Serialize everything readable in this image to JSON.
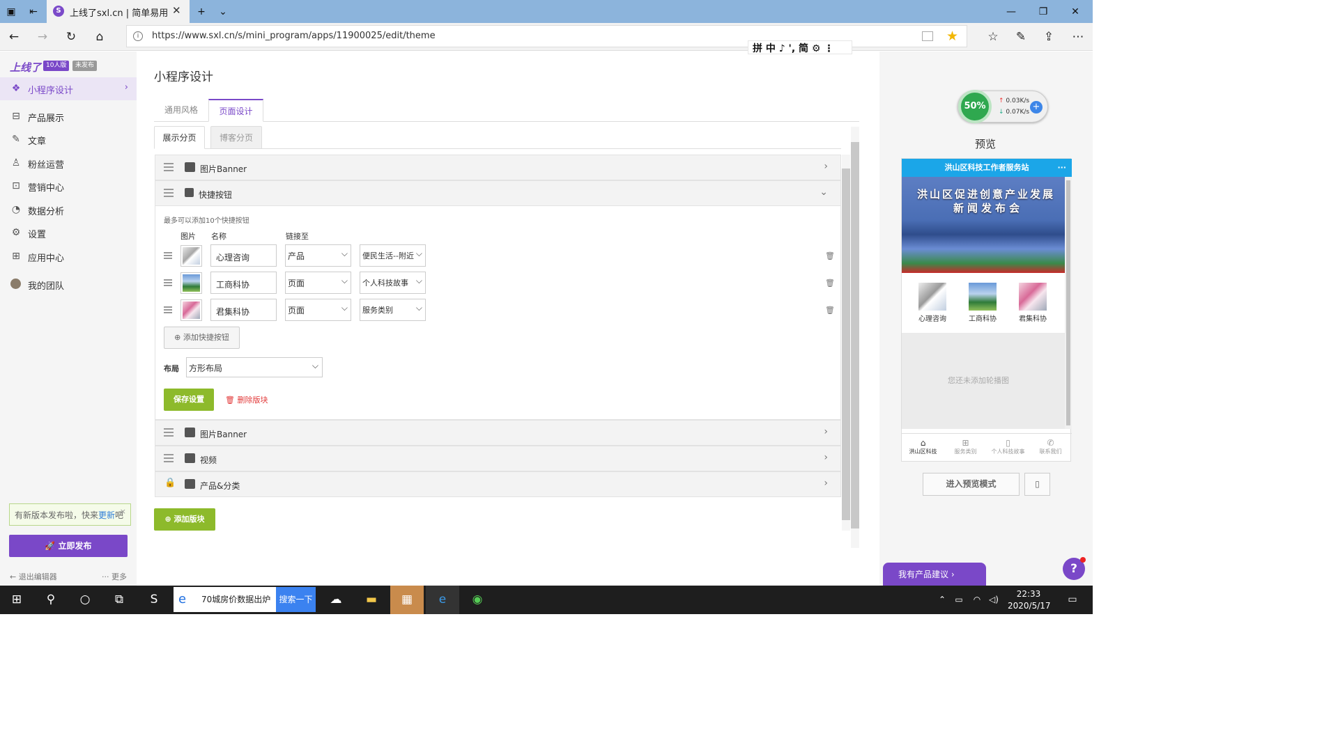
{
  "browser": {
    "tab_title": "上线了sxl.cn | 简单易用",
    "url": "https://www.sxl.cn/s/mini_program/apps/11900025/edit/theme",
    "ime_bar": "拼 中 ♪ ', 简 ⚙ ⋮",
    "window_controls": [
      "minimize",
      "restore",
      "close"
    ]
  },
  "sidebar": {
    "logo": "上线了",
    "badge_edition": "10人版",
    "badge_status": "未发布",
    "items": [
      {
        "label": "小程序设计",
        "icon": "layers-icon",
        "active": true
      },
      {
        "label": "产品展示",
        "icon": "bag-icon"
      },
      {
        "label": "文章",
        "icon": "pen-icon"
      },
      {
        "label": "粉丝运营",
        "icon": "user-icon"
      },
      {
        "label": "营销中心",
        "icon": "ticket-icon"
      },
      {
        "label": "数据分析",
        "icon": "pie-icon"
      },
      {
        "label": "设置",
        "icon": "gear-icon"
      },
      {
        "label": "应用中心",
        "icon": "apps-icon"
      },
      {
        "label": "我的团队",
        "icon": "team-avatar"
      }
    ],
    "update_tip_prefix": "有新版本发布啦，快来",
    "update_tip_link": "更新",
    "update_tip_suffix": "吧",
    "publish_label": "立即发布",
    "exit_label": "退出编辑器",
    "more_label": "··· 更多"
  },
  "main": {
    "page_title": "小程序设计",
    "tabs": [
      {
        "label": "通用风格",
        "active": false
      },
      {
        "label": "页面设计",
        "active": true
      }
    ],
    "subtabs": [
      {
        "label": "展示分页",
        "active": true
      },
      {
        "label": "博客分页",
        "active": false
      }
    ],
    "sections_before": [
      {
        "label": "图片Banner",
        "icon": "image-icon"
      }
    ],
    "quick_section": {
      "label": "快捷按钮",
      "hint": "最多可以添加10个快捷按钮",
      "col_image": "图片",
      "col_name": "名称",
      "col_link": "链接至",
      "rows": [
        {
          "name": "心理咨询",
          "link_type": "产品",
          "link_target": "便民生活--附近"
        },
        {
          "name": "工商科协",
          "link_type": "页面",
          "link_target": "个人科技故事"
        },
        {
          "name": "君集科协",
          "link_type": "页面",
          "link_target": "服务类别"
        }
      ],
      "add_label": "添加快捷按钮",
      "layout_label": "布局",
      "layout_value": "方形布局",
      "save_label": "保存设置",
      "delete_label": "删除版块"
    },
    "sections_after": [
      {
        "label": "图片Banner",
        "icon": "image-icon"
      },
      {
        "label": "视频",
        "icon": "film-icon"
      },
      {
        "label": "产品&分类",
        "icon": "box-icon"
      }
    ],
    "add_block_label": "添加版块"
  },
  "preview": {
    "speed_percent": "50%",
    "speed_up": "0.03K/s",
    "speed_down": "0.07K/s",
    "title": "预览",
    "phone_header": "洪山区科技工作者服务站",
    "phone_header_dots": "···",
    "banner_line1": "洪山区促进创意产业发展",
    "banner_line2": "新闻发布会",
    "quick_labels": [
      "心理咨询",
      "工商科协",
      "君集科协"
    ],
    "carousel_empty": "您还未添加轮播图",
    "bottom_tabs": [
      {
        "label": "洪山区科技",
        "icon": "home-icon",
        "active": true
      },
      {
        "label": "服务类别",
        "icon": "grid-icon"
      },
      {
        "label": "个人科技故事",
        "icon": "book-icon"
      },
      {
        "label": "联系我们",
        "icon": "phone-icon"
      }
    ],
    "enter_preview_label": "进入预览模式",
    "suggest_label": "我有产品建议",
    "help_label": "?"
  },
  "taskbar": {
    "search_text": "70城房价数据出炉",
    "search_button": "搜索一下",
    "time": "22:33",
    "date": "2020/5/17"
  },
  "colors": {
    "brand_purple": "#7a48c8",
    "save_green": "#8dba2b",
    "phone_header_blue": "#1ba6e8"
  }
}
